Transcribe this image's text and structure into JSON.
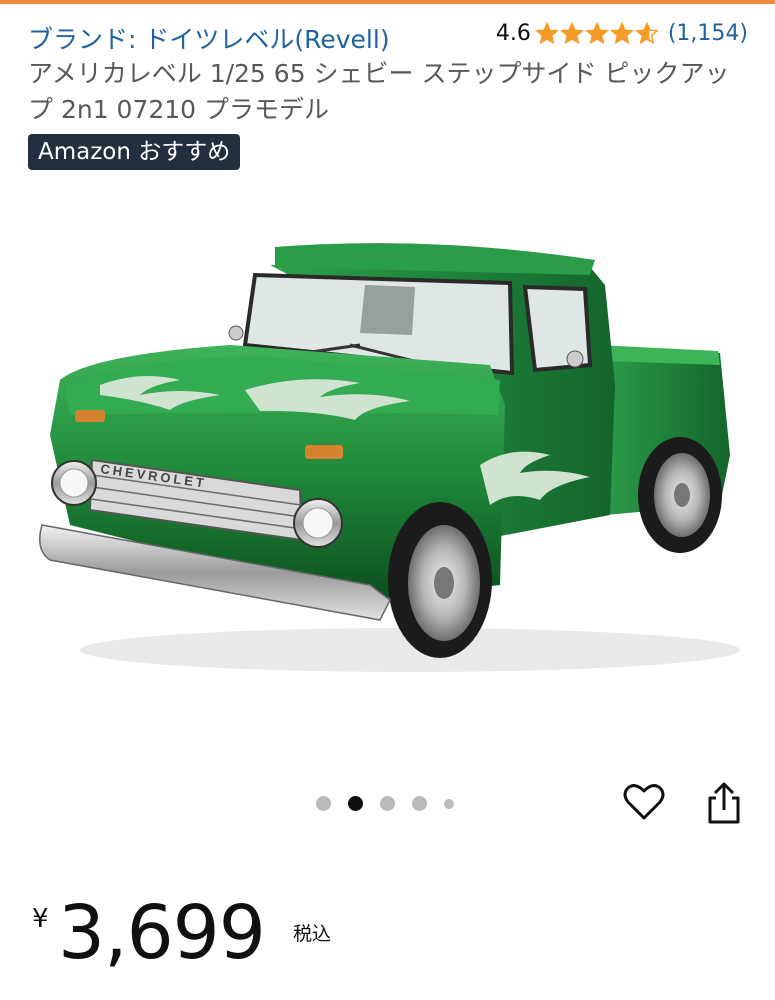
{
  "product": {
    "brand_link": "ブランド: ドイツレベル(Revell)",
    "rating_value": "4.6",
    "rating_stars": 4.6,
    "rating_count": "(1,154)",
    "title": "アメリカレベル 1/25 65 シェビー ステップサイド ピックアップ 2n1 07210 プラモデル",
    "badge": "Amazon おすすめ",
    "grille_lettering": "CHEVROLET"
  },
  "gallery": {
    "total_images": 5,
    "active_index": 2,
    "heart_icon": "heart-outline-icon",
    "share_icon": "share-icon"
  },
  "price": {
    "symbol": "¥",
    "value": "3,699",
    "tax_label": "税込"
  },
  "colors": {
    "link": "#2162a1",
    "star": "#f59b27",
    "badge_bg": "#232f3e",
    "accent_top": "#f08a3c",
    "truck_green": "#1f8a3a"
  }
}
